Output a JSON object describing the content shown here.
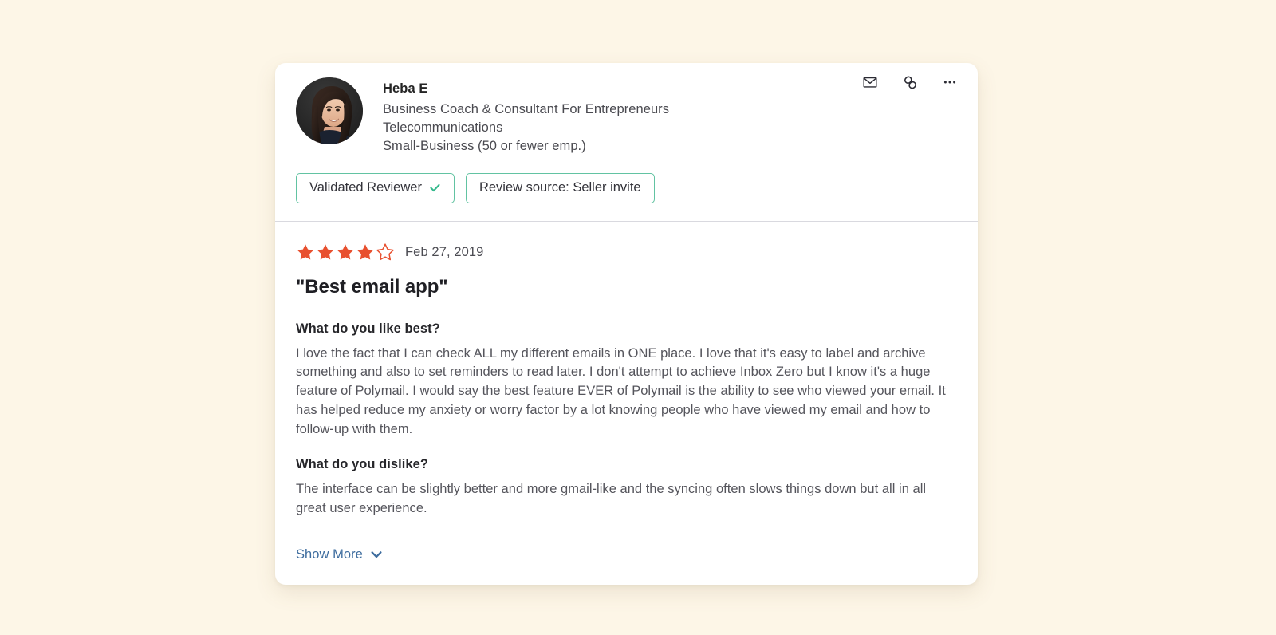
{
  "review_card": {
    "reviewer": {
      "name": "Heba E",
      "title": "Business Coach & Consultant For Entrepreneurs",
      "industry": "Telecommunications",
      "company_size": "Small-Business (50 or fewer emp.)",
      "avatar_alt": "Heba E profile photo"
    },
    "header_actions": [
      {
        "name": "email-icon",
        "label": "Email"
      },
      {
        "name": "link-icon",
        "label": "Copy link"
      },
      {
        "name": "more-options-icon",
        "label": "More options"
      }
    ],
    "badges": [
      {
        "label": "Validated Reviewer",
        "has_check": true
      },
      {
        "label": "Review source: Seller invite",
        "has_check": false
      }
    ],
    "rating": {
      "value": 4,
      "max": 5,
      "filled_color": "#e8502f",
      "empty_color": "#e8502f"
    },
    "date": "Feb 27, 2019",
    "title": "\"Best email app\"",
    "sections": [
      {
        "question": "What do you like best?",
        "answer": "I love the fact that I can check ALL my different emails in ONE place. I love that it's easy to label and archive something and also to set reminders to read later. I don't attempt to achieve Inbox Zero but I know it's a huge feature of Polymail. I would say the best feature EVER of Polymail is the ability to see who viewed your email. It has helped reduce my anxiety or worry factor by a lot knowing people who have viewed my email and how to follow-up with them."
      },
      {
        "question": "What do you dislike?",
        "answer": "The interface can be slightly better and more gmail-like and the syncing often slows things down but all in all great user experience."
      }
    ],
    "show_more_label": "Show More"
  },
  "theme": {
    "page_background": "#fdf6e7",
    "card_background": "#ffffff",
    "badge_border": "#62c3a2",
    "check_color": "#34b98c",
    "link_color": "#3d6c9e",
    "star_color": "#e8502f"
  }
}
